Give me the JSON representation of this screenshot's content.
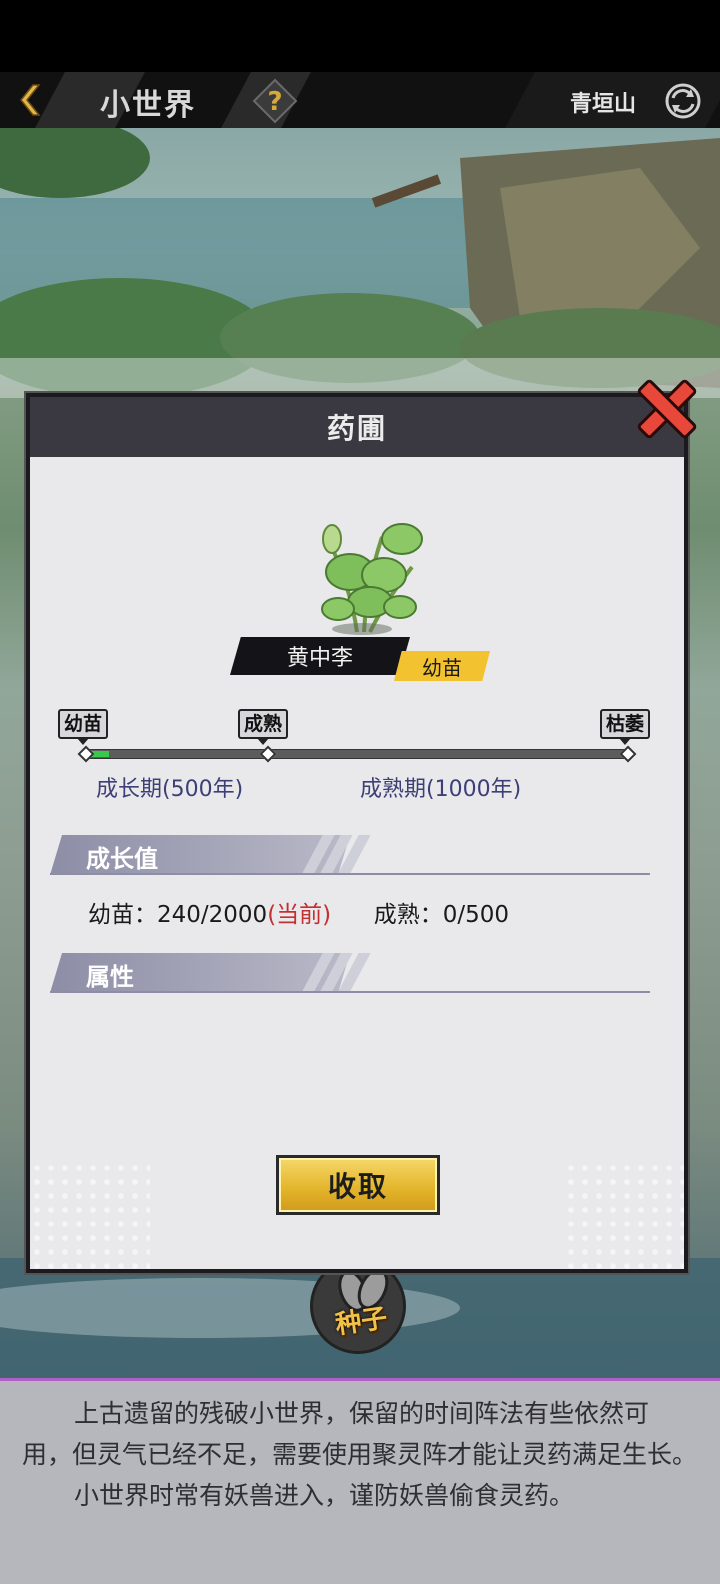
{
  "header": {
    "title": "小世界",
    "region": "青垣山"
  },
  "modal": {
    "title": "药圃",
    "plant_name": "黄中李",
    "plant_stage": "幼苗",
    "stages": {
      "seedling": "幼苗",
      "mature": "成熟",
      "withered": "枯萎"
    },
    "periods": {
      "growth": "成长期(500年)",
      "mature": "成熟期(1000年)"
    },
    "progress_fraction": 0.04,
    "growth_section_title": "成长值",
    "growth": {
      "seedling_label": "幼苗：",
      "seedling_value": "240/2000",
      "current_marker": "(当前)",
      "mature_label": "成熟：",
      "mature_value": "0/500"
    },
    "attribute_section_title": "属性",
    "collect_button": "收取"
  },
  "seed_button": {
    "label": "种子"
  },
  "description": {
    "paragraph1": "上古遗留的残破小世界，保留的时间阵法有些依然可用，但灵气已经不足，需要使用聚灵阵才能让灵药满足生长。",
    "paragraph2": "小世界时常有妖兽进入，谨防妖兽偷食灵药。"
  },
  "colors": {
    "accent_gold": "#f2c230",
    "progress_green": "#38c94a",
    "current_red": "#c33030",
    "header_dark": "#3a3942"
  }
}
